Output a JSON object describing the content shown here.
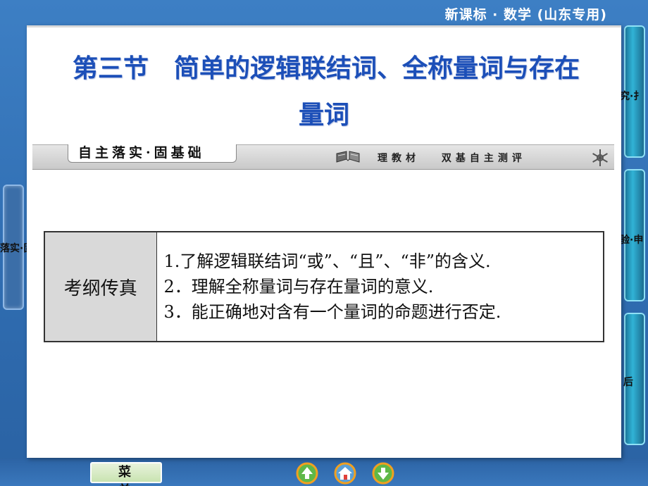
{
  "header": {
    "title": "新课标 · 数学 (山东专用)"
  },
  "slide": {
    "title_line1": "第三节　简单的逻辑联结词、全称量词与存在",
    "title_line2": "量词",
    "banner": {
      "tab_text": "自主落实·固基础",
      "slogan": "理教材　 双基自主测评"
    },
    "requirements": {
      "label": "考纲传真",
      "items": [
        "1.了解逻辑联结词“或”、“且”、“非”的含义.",
        "2．理解全称量词与存在量词的意义.",
        "3．能正确地对含有一个量词的命题进行否定."
      ]
    }
  },
  "side_nav": {
    "left_label": "落实·固基",
    "right_labels": [
      "典例探究·扌",
      "高考体验·申",
      "课 后　 作"
    ]
  },
  "bottom_nav": {
    "menu_label": "菜单",
    "icons": [
      "prev-arrow-icon",
      "home-icon",
      "next-arrow-icon"
    ]
  },
  "colors": {
    "background": "#2f6cb0",
    "title": "#1c4fb8",
    "table_label_bg": "#d9d9d9",
    "menu_bg": "#c9e3b1"
  }
}
